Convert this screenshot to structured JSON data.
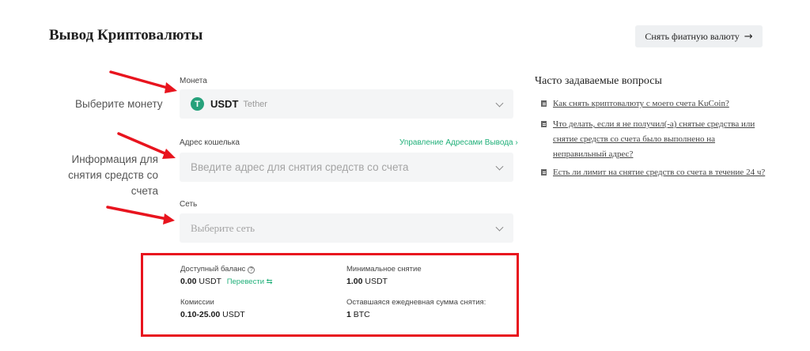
{
  "header": {
    "title": "Вывод Криптовалюты",
    "fiat_button_label": "Снять фиатную валюту",
    "fiat_button_icon": "arrow-right-icon"
  },
  "annotations": {
    "select_coin": "Выберите монету",
    "withdraw_info_line1": "Информация для",
    "withdraw_info_line2": "снятия средств со счета",
    "arrow_color": "#e8141e"
  },
  "form": {
    "coin": {
      "label": "Монета",
      "code": "USDT",
      "name": "Tether",
      "icon": "tether-icon",
      "icon_color": "#26a17b"
    },
    "address": {
      "label": "Адрес кошелька",
      "manage_link": "Управление Адресами Вывода",
      "placeholder": "Введите адрес для снятия средств со счета"
    },
    "network": {
      "label": "Сеть",
      "placeholder": "Выберите сеть"
    }
  },
  "info": {
    "available_balance": {
      "label": "Доступный баланс",
      "amount": "0.00",
      "unit": "USDT",
      "transfer_label": "Перевести"
    },
    "min_withdrawal": {
      "label": "Минимальное снятие",
      "amount": "1.00",
      "unit": "USDT"
    },
    "fees": {
      "label": "Комиссии",
      "amount": "0.10-25.00",
      "unit": "USDT"
    },
    "remaining_daily": {
      "label": "Оставшаяся ежедневная сумма снятия:",
      "amount": "1",
      "unit": "BTC"
    },
    "highlight_color": "#e8141e"
  },
  "faq": {
    "title": "Часто задаваемые вопросы",
    "items": [
      {
        "line1": "Как снять криптовалюту с моего счета KuCoin?"
      },
      {
        "line1": "Что делать, если я не получил(-а) снятые средства или",
        "line2": "снятие средств со счета было выполнено на",
        "line3": "неправильный адрес?"
      },
      {
        "line1": "Есть ли лимит на снятие средств со счета в течение 24 ч?"
      }
    ]
  }
}
